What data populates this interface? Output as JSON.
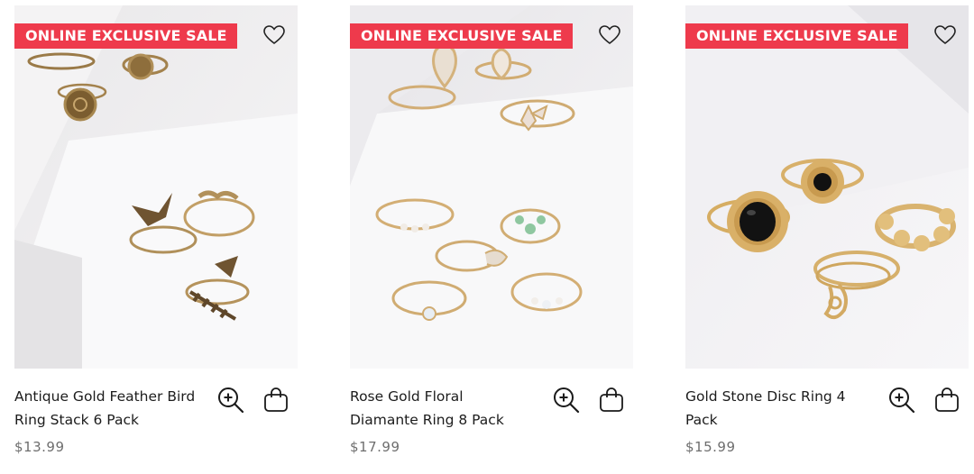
{
  "products": [
    {
      "badge": "ONLINE EXCLUSIVE SALE",
      "name": "Antique Gold Feather Bird Ring Stack 6 Pack",
      "price": "$13.99",
      "wishlist_icon": "heart-outline-icon",
      "zoom_icon": "zoom-in-icon",
      "cart_icon": "shopping-bag-icon"
    },
    {
      "badge": "ONLINE EXCLUSIVE SALE",
      "name": "Rose Gold Floral Diamante Ring 8 Pack",
      "price": "$17.99",
      "wishlist_icon": "heart-outline-icon",
      "zoom_icon": "zoom-in-icon",
      "cart_icon": "shopping-bag-icon"
    },
    {
      "badge": "ONLINE EXCLUSIVE SALE",
      "name": "Gold Stone Disc Ring 4 Pack",
      "price": "$15.99",
      "wishlist_icon": "heart-outline-icon",
      "zoom_icon": "zoom-in-icon",
      "cart_icon": "shopping-bag-icon"
    }
  ],
  "colors": {
    "badge_bg": "#ee3a4c",
    "badge_text": "#ffffff",
    "name_text": "#1c1c1c",
    "price_text": "#6e6e6e",
    "gold": "#c9a060",
    "antique_gold": "#8a6a3a",
    "black_stone": "#141414"
  }
}
